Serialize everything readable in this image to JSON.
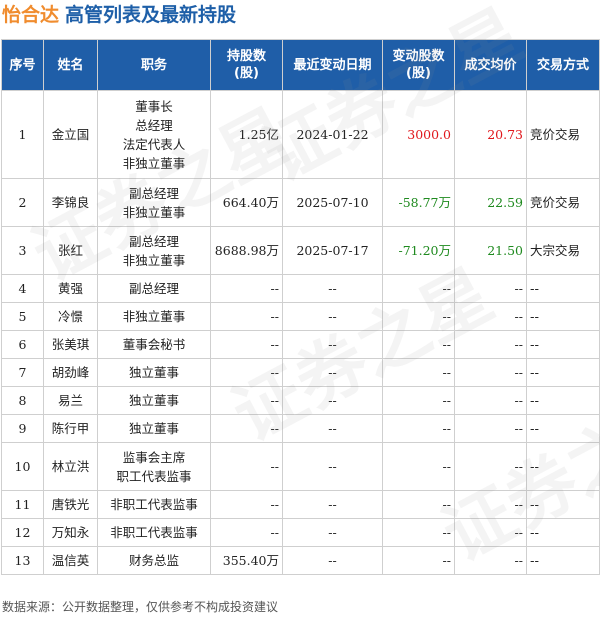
{
  "header": {
    "company": "怡合达",
    "subtitle": "高管列表及最新持股"
  },
  "columns": [
    "序号",
    "姓名",
    "职务",
    "持股数\n(股)",
    "最近变动日期",
    "变动股数\n(股)",
    "成交均价",
    "交易方式"
  ],
  "rows": [
    {
      "idx": "1",
      "name": "金立国",
      "roles": [
        "董事长",
        "总经理",
        "法定代表人",
        "非独立董事"
      ],
      "shares": "1.25亿",
      "date": "2024-01-22",
      "change": "3000.0",
      "price": "20.73",
      "method": "竞价交易",
      "change_color": "red",
      "price_color": "red"
    },
    {
      "idx": "2",
      "name": "李锦良",
      "roles": [
        "副总经理",
        "非独立董事"
      ],
      "shares": "664.40万",
      "date": "2025-07-10",
      "change": "-58.77万",
      "price": "22.59",
      "method": "竞价交易",
      "change_color": "green",
      "price_color": "green"
    },
    {
      "idx": "3",
      "name": "张红",
      "roles": [
        "副总经理",
        "非独立董事"
      ],
      "shares": "8688.98万",
      "date": "2025-07-17",
      "change": "-71.20万",
      "price": "21.50",
      "method": "大宗交易",
      "change_color": "green",
      "price_color": "green"
    },
    {
      "idx": "4",
      "name": "黄强",
      "roles": [
        "副总经理"
      ],
      "shares": "--",
      "date": "--",
      "change": "--",
      "price": "--",
      "method": "--"
    },
    {
      "idx": "5",
      "name": "冷憬",
      "roles": [
        "非独立董事"
      ],
      "shares": "--",
      "date": "--",
      "change": "--",
      "price": "--",
      "method": "--"
    },
    {
      "idx": "6",
      "name": "张美琪",
      "roles": [
        "董事会秘书"
      ],
      "shares": "--",
      "date": "--",
      "change": "--",
      "price": "--",
      "method": "--"
    },
    {
      "idx": "7",
      "name": "胡劲峰",
      "roles": [
        "独立董事"
      ],
      "shares": "--",
      "date": "--",
      "change": "--",
      "price": "--",
      "method": "--"
    },
    {
      "idx": "8",
      "name": "易兰",
      "roles": [
        "独立董事"
      ],
      "shares": "--",
      "date": "--",
      "change": "--",
      "price": "--",
      "method": "--"
    },
    {
      "idx": "9",
      "name": "陈行甲",
      "roles": [
        "独立董事"
      ],
      "shares": "--",
      "date": "--",
      "change": "--",
      "price": "--",
      "method": "--"
    },
    {
      "idx": "10",
      "name": "林立洪",
      "roles": [
        "监事会主席",
        "职工代表监事"
      ],
      "shares": "--",
      "date": "--",
      "change": "--",
      "price": "--",
      "method": "--"
    },
    {
      "idx": "11",
      "name": "唐铁光",
      "roles": [
        "非职工代表监事"
      ],
      "shares": "--",
      "date": "--",
      "change": "--",
      "price": "--",
      "method": "--"
    },
    {
      "idx": "12",
      "name": "万知永",
      "roles": [
        "非职工代表监事"
      ],
      "shares": "--",
      "date": "--",
      "change": "--",
      "price": "--",
      "method": "--"
    },
    {
      "idx": "13",
      "name": "温信英",
      "roles": [
        "财务总监"
      ],
      "shares": "355.40万",
      "date": "--",
      "change": "--",
      "price": "--",
      "method": "--"
    }
  ],
  "footer": "数据来源：公开数据整理，仅供参考不构成投资建议",
  "watermark": "证券之星",
  "colors": {
    "header_bg": "#1f5ea8",
    "company": "#f08c2e",
    "subtitle": "#1e5fa8",
    "up": "#e0161b",
    "down": "#1f8a1f"
  }
}
